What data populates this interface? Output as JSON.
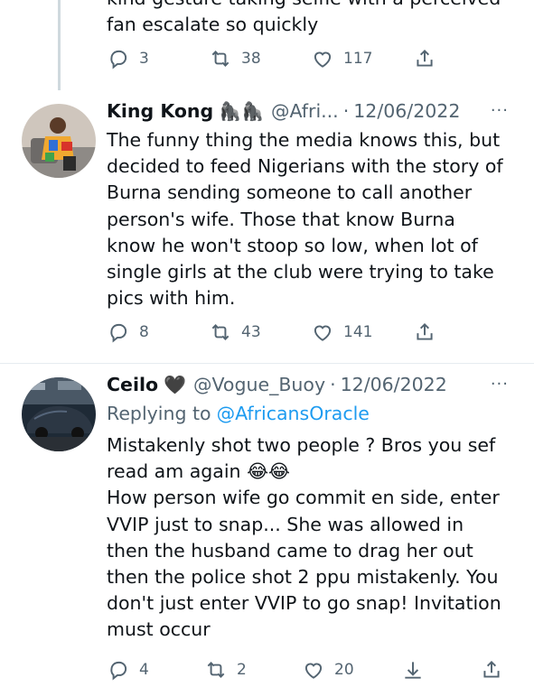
{
  "tweets": [
    {
      "partial_line": "kind gesture taking selfie with a perceived",
      "text_lines": [
        "fan escalate so quickly"
      ],
      "stats": {
        "replies": "3",
        "retweets": "38",
        "likes": "117"
      }
    },
    {
      "name": "King Kong",
      "name_emoji": "🦍🦍",
      "handle": "@Afri...",
      "dot": "·",
      "date": "12/06/2022",
      "more": "···",
      "text_lines": [
        "The funny thing the media knows this, but",
        "decided to feed Nigerians with the story of",
        "Burna sending someone to call another",
        "person's wife. Those that know Burna",
        "know he won't stoop so low, when lot of",
        "single girls at the club were trying to take",
        "pics with him."
      ],
      "stats": {
        "replies": "8",
        "retweets": "43",
        "likes": "141"
      }
    },
    {
      "name": "Ceilo",
      "name_emoji": "🖤",
      "handle": "@Vogue_Buoy",
      "dot": "·",
      "date": "12/06/2022",
      "more": "···",
      "replying_prefix": "Replying to",
      "replying_handle": "@AfricansOracle",
      "text_lines": [
        "Mistakenly shot two people ? Bros you sef",
        "read am again 😂😂",
        "How person wife go commit en side, enter",
        "VVIP just to snap... She was allowed in",
        "then the husband came to drag her out",
        "then the police shot 2 ppu mistakenly. You",
        "don't just enter VVIP to go snap! Invitation",
        "must occur"
      ],
      "stats": {
        "replies": "4",
        "retweets": "2",
        "likes": "20"
      }
    }
  ],
  "colors": {
    "text": "#0f1419",
    "muted": "#536471",
    "link": "#1d9bf0",
    "thread": "#cfd9de",
    "divider": "#e6ecf0"
  },
  "icons": [
    "reply-icon",
    "retweet-icon",
    "like-icon",
    "share-icon",
    "download-icon"
  ]
}
